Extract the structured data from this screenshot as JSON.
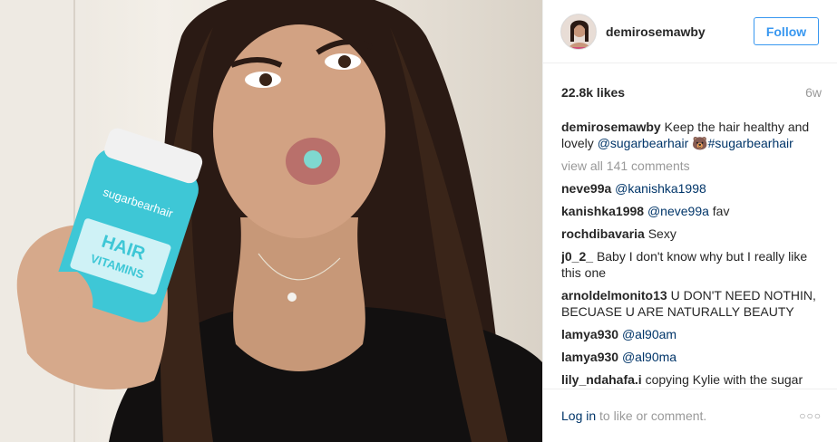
{
  "post": {
    "username": "demirosemawby",
    "follow_label": "Follow",
    "likes": "22.8k likes",
    "age": "6w"
  },
  "caption": {
    "user": "demirosemawby",
    "text": " Keep the hair healthy and lovely ",
    "mention": "@sugarbearhair",
    "emoji": "🐻",
    "hashtag": "#sugarbearhair"
  },
  "view_all": "view all 141 comments",
  "comments": [
    {
      "user": "neve99a",
      "text": "",
      "mention": "@kanishka1998"
    },
    {
      "user": "kanishka1998",
      "text": " fav",
      "mention": "@neve99a"
    },
    {
      "user": "rochdibavaria",
      "text": "Sexy",
      "mention": ""
    },
    {
      "user": "j0_2_",
      "text": "Baby I don't know why but I really like this one",
      "mention": ""
    },
    {
      "user": "arnoldelmonito13",
      "text": "U DON'T NEED NOTHIN, BECUASE U ARE NATURALLY BEAUTY",
      "mention": ""
    },
    {
      "user": "lamya930",
      "text": "",
      "mention": "@al90am"
    },
    {
      "user": "lamya930",
      "text": "",
      "mention": "@al90ma"
    },
    {
      "user": "lily_ndahafa.i",
      "text": "copying Kylie with the sugar",
      "mention": ""
    }
  ],
  "footer": {
    "login_label": "Log in",
    "message": " to like or comment.",
    "more_icon": "ellipsis-icon",
    "more_glyph": "○○○"
  },
  "photo": {
    "bottle_brand": "sugarbearhair",
    "bottle_line1": "HAIR",
    "bottle_line2": "VITAMINS",
    "accent": "#3ec7d6"
  },
  "colors": {
    "link": "#003569",
    "follow": "#3897f0",
    "muted": "#999999"
  }
}
